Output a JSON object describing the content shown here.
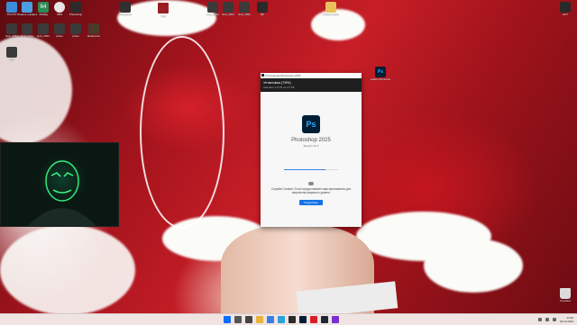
{
  "desktop": {
    "icons": [
      {
        "id": "top-1",
        "label": "This PC",
        "icon": "pc-icon",
        "color": "#3a8fd8"
      },
      {
        "id": "top-2",
        "label": "Панель управления",
        "icon": "control-panel-icon",
        "color": "#4a9fe0"
      },
      {
        "id": "top-3",
        "label": "x64dbg",
        "icon": "x64dbg-icon",
        "color": "#2e8b57"
      },
      {
        "id": "top-4",
        "label": "OBS",
        "icon": "obs-icon",
        "color": "#e6e6e6"
      },
      {
        "id": "top-5",
        "label": "Photoshop",
        "icon": "folder-icon",
        "color": "#2b2b2b"
      },
      {
        "id": "top-6",
        "label": "HostEditor",
        "icon": "app-icon",
        "color": "#303030"
      },
      {
        "id": "top-7",
        "label": "Text",
        "icon": "file-icon",
        "color": "#9a1e24"
      },
      {
        "id": "top-8",
        "label": "Sub_2024",
        "icon": "file-icon",
        "color": "#3a3a3a"
      },
      {
        "id": "top-9",
        "label": "Sub_2024",
        "icon": "file-icon",
        "color": "#3a3a3a"
      },
      {
        "id": "top-10",
        "label": "Sub_2024",
        "icon": "file-icon",
        "color": "#3a3a3a"
      },
      {
        "id": "top-11",
        "label": "ВК",
        "icon": "folder-icon",
        "color": "#2a2a2a"
      },
      {
        "id": "top-12",
        "label": "Новая папка",
        "icon": "folder-icon",
        "color": "#e8c15a"
      },
      {
        "id": "top-13",
        "label": "НОТ",
        "icon": "app-icon",
        "color": "#2a2a2a"
      },
      {
        "id": "row2-1",
        "label": "Sub_2024",
        "icon": "file-icon",
        "color": "#3a3a3a"
      },
      {
        "id": "row2-2",
        "label": "Sub_2024",
        "icon": "file-icon",
        "color": "#3a3a3a"
      },
      {
        "id": "row2-3",
        "label": "Sub_2024",
        "icon": "file-icon",
        "color": "#3a3a3a"
      },
      {
        "id": "row2-4",
        "label": "photo",
        "icon": "file-icon",
        "color": "#3a3a3a"
      },
      {
        "id": "row2-5",
        "label": "photo",
        "icon": "file-icon",
        "color": "#3a3a3a"
      },
      {
        "id": "row2-6",
        "label": "Reference",
        "icon": "app-icon",
        "color": "#4a3a2a"
      },
      {
        "id": "left-1",
        "label": "Sub",
        "icon": "file-icon",
        "color": "#3a3a3a"
      },
      {
        "id": "ps-shortcut",
        "label": "Adobe Photoshop",
        "icon": "photoshop-icon",
        "color": "#001e36"
      },
      {
        "id": "recycle",
        "label": "Корзина",
        "icon": "recycle-bin-icon",
        "color": "#dcdcdc"
      }
    ]
  },
  "installer": {
    "window_title": "Установщик Photoshop 2025",
    "heading": "Установка (76%)",
    "subheading": "Скачано 1,5 ГБ из 2,0 ГБ",
    "product_icon_text": "Ps",
    "product_name": "Photoshop 2025",
    "version": "Версия 26.2",
    "progress": 0.76,
    "message": "Служба Creative Cloud предоставляет вам приложения для творчества мирового уровня.",
    "more_button": "Подробнее",
    "accent_color": "#1473e6"
  },
  "taskbar": {
    "apps": [
      {
        "name": "windows-start-icon",
        "color": "#0a6cff"
      },
      {
        "name": "search-icon",
        "color": "#555555"
      },
      {
        "name": "task-view-icon",
        "color": "#444444"
      },
      {
        "name": "file-explorer-icon",
        "color": "#e8b43a"
      },
      {
        "name": "browser-icon",
        "color": "#3a7fe0"
      },
      {
        "name": "telegram-icon",
        "color": "#2aa3de"
      },
      {
        "name": "obs-icon",
        "color": "#2b2b2b"
      },
      {
        "name": "photoshop-icon",
        "color": "#001e36"
      },
      {
        "name": "creative-cloud-icon",
        "color": "#da1f26"
      },
      {
        "name": "steam-icon",
        "color": "#1b2838"
      },
      {
        "name": "media-icon",
        "color": "#7a2fd0"
      }
    ],
    "time": "13:46",
    "date": "18.12.2024"
  }
}
